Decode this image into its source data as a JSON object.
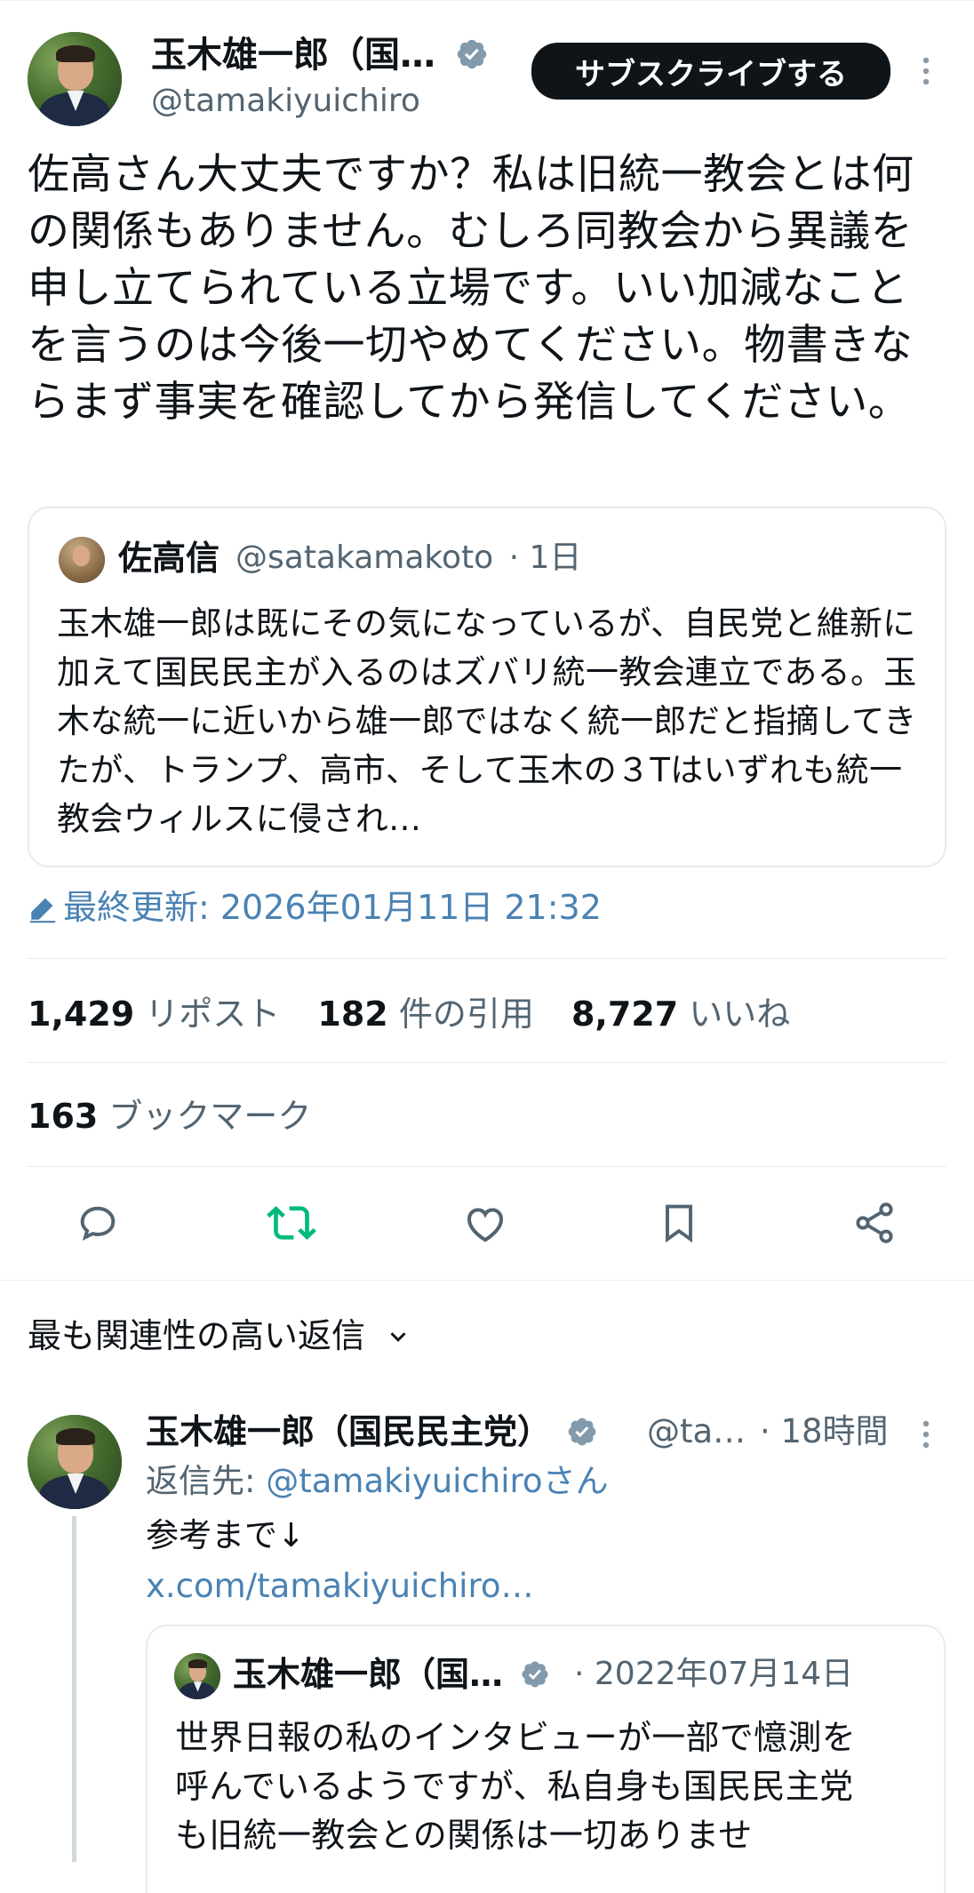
{
  "tweet": {
    "author_name": "玉木雄一郎（国…",
    "author_handle": "@tamakiyuichiro",
    "subscribe_label": "サブスクライブする",
    "text": "佐高さん大丈夫ですか？私は旧統一教会とは何の関係もありません。むしろ同教会から異議を申し立てられている立場です。いい加減なことを言うのは今後一切やめてください。物書きならまず事実を確認してから発信してください。",
    "quoted": {
      "name": "佐高信",
      "handle": "@satakamakoto",
      "time": "· 1日",
      "text": "玉木雄一郎は既にその気になっているが、自民党と維新に加えて国民民主が入るのはズバリ統一教会連立である。玉木な統一に近いから雄一郎ではなく統一郎だと指摘してきたが、トランプ、高市、そして玉木の３Tはいずれも統一教会ウィルスに侵され…"
    },
    "updated_label": "最終更新: 2026年01月11日 21:32",
    "stats": {
      "reposts_count": "1,429",
      "reposts_label": "リポスト",
      "quotes_count": "182",
      "quotes_label": "件の引用",
      "likes_count": "8,727",
      "likes_label": "いいね",
      "bookmarks_count": "163",
      "bookmarks_label": "ブックマーク"
    },
    "actions": {
      "reply": "reply-icon",
      "repost": "repost-icon",
      "like": "heart-icon",
      "bookmark": "bookmark-icon",
      "share": "share-icon",
      "repost_color": "#00ba7c"
    }
  },
  "replies": {
    "sort_label": "最も関連性の高い返信",
    "items": [
      {
        "name": "玉木雄一郎（国民民主党）",
        "handle": "@ta…",
        "time": "· 18時間",
        "reply_to_prefix": "返信先: ",
        "reply_to_handle": "@tamakiyuichiroさん",
        "text": "参考まで↓",
        "link": "x.com/tamakiyuichiro…",
        "quoted": {
          "name": "玉木雄一郎（国…",
          "time": "· 2022年07月14日",
          "text": "世界日報の私のインタビューが一部で憶測を呼んでいるようですが、私自身も国民民主党も旧統一教会との関係は一切ありませ"
        }
      }
    ]
  },
  "colors": {
    "link_blue": "#4a82b3",
    "verified_gray": "#829aab",
    "text_primary": "#0f1419",
    "text_secondary": "#536471"
  }
}
